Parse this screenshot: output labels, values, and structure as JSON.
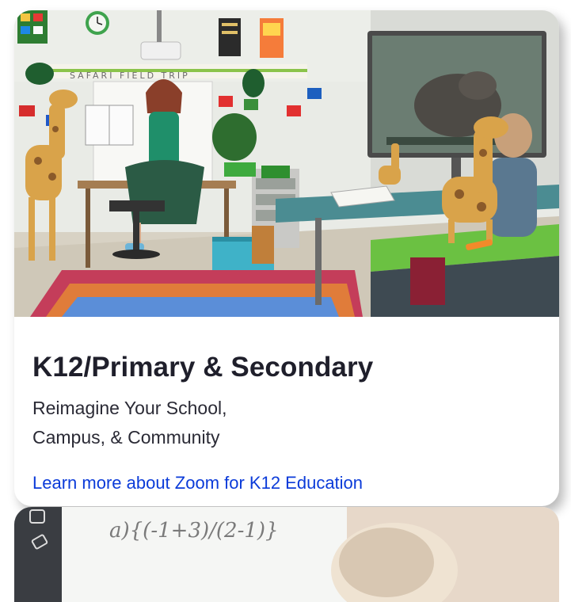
{
  "card1": {
    "image_alt": "Teacher reading to a classroom with stuffed giraffes and a large video display",
    "board_text": "SAFARI FIELD TRIP",
    "title": "K12/Primary & Secondary",
    "description_line1": "Reimagine Your School,",
    "description_line2": "Campus, & Community",
    "link_label": "Learn more about Zoom for K12 Education",
    "link_color": "#0b3bd9"
  },
  "card2": {
    "whiteboard_text": "a){(-1+3)/(2-1)}"
  }
}
